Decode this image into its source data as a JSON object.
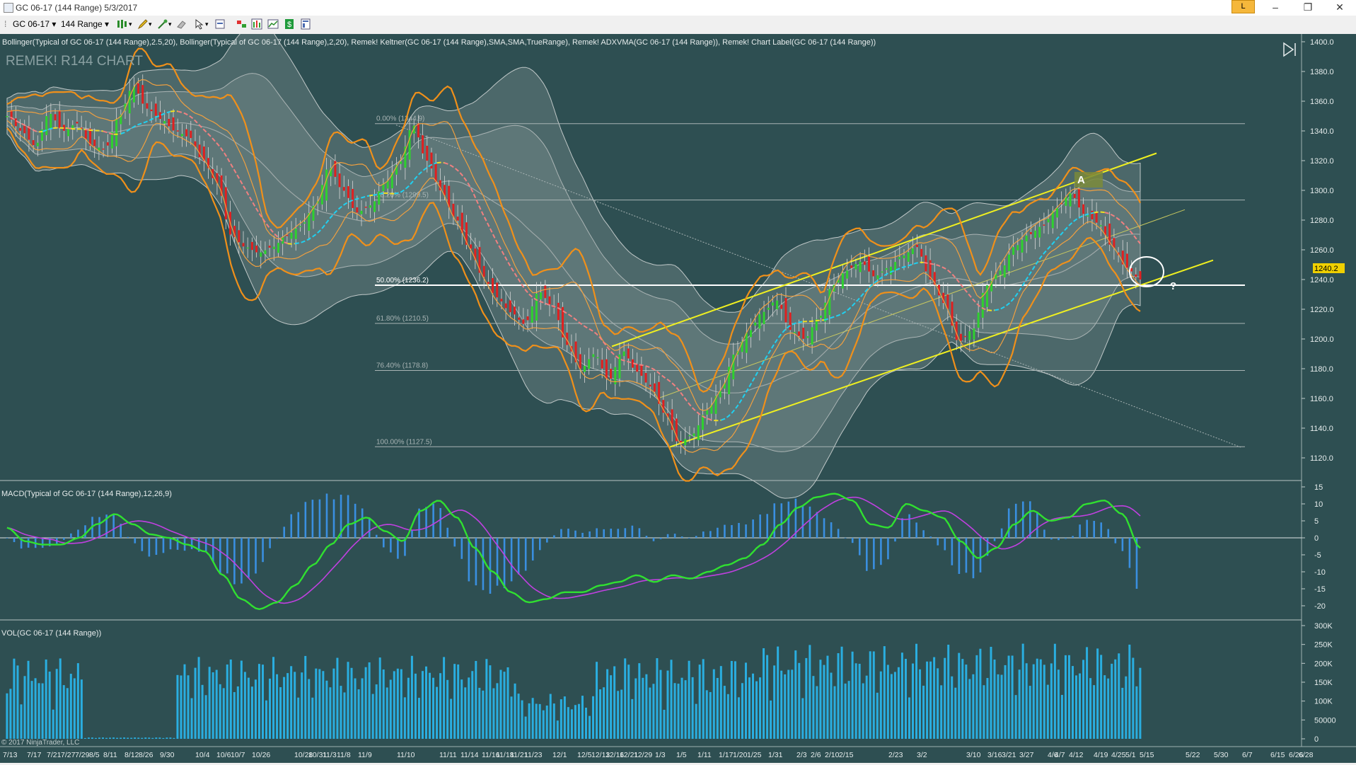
{
  "window": {
    "title": "GC 06-17 (144 Range)  5/3/2017",
    "badge": "L",
    "minimize": "–",
    "maximize": "❐",
    "close": "✕"
  },
  "toolbar": {
    "instrument": "GC 06-17",
    "period": "144 Range"
  },
  "price_panel": {
    "indicators_label": "Bollinger(Typical of GC 06-17 (144 Range),2.5,20), Bollinger(Typical of GC 06-17 (144 Range),2,20), Remek! Keltner(GC 06-17 (144 Range),SMA,SMA,TrueRange), Remek! ADXVMA(GC 06-17 (144 Range)), Remek! Chart Label(GC 06-17 (144 Range))",
    "watermark": "REMEK! R144 CHART",
    "label_a": "A",
    "question_mark": "?",
    "last_price": "1240.2",
    "copyright": "© 2017 NinjaTrader, LLC",
    "fib_levels": [
      {
        "label": "0.00% (1344.9)",
        "price": 1344.9
      },
      {
        "label": "38.20% (1299.5)",
        "price": 1293.5
      },
      {
        "label": "50.00% (1236.2)",
        "price": 1236.2
      },
      {
        "label": "61.80% (1210.5)",
        "price": 1210.5
      },
      {
        "label": "76.40% (1178.8)",
        "price": 1178.8
      },
      {
        "label": "100.00% (1127.5)",
        "price": 1127.5
      }
    ]
  },
  "macd_panel": {
    "label": "MACD(Typical of GC 06-17 (144 Range),12,26,9)"
  },
  "vol_panel": {
    "label": "VOL(GC 06-17 (144 Range))"
  },
  "x_axis_labels": [
    "7/13",
    "7/17",
    "7/21",
    "7/27",
    "7/29",
    "8/5",
    "8/11",
    "8/12",
    "8/26",
    "9/30",
    "10/4",
    "10/6",
    "10/7",
    "10/26",
    "10/28",
    "10/31",
    "11/3",
    "11/8",
    "11/9",
    "11/10",
    "11/11",
    "11/14",
    "11/16",
    "11/18",
    "11/21",
    "11/23",
    "12/1",
    "12/5",
    "12/13",
    "12/16",
    "12/21",
    "12/29",
    "1/3",
    "1/5",
    "1/11",
    "1/17",
    "1/20",
    "1/25",
    "1/31",
    "2/3",
    "2/6",
    "2/10",
    "2/15",
    "2/23",
    "3/2",
    "3/10",
    "3/16",
    "3/21",
    "3/27",
    "4/6",
    "4/7",
    "4/12",
    "4/19",
    "4/25",
    "5/1",
    "5/15",
    "5/22",
    "5/30",
    "6/7",
    "6/15",
    "6/26",
    "6/28"
  ],
  "chart_data": [
    {
      "type": "candlestick",
      "title": "GC 06-17 (144 Range)",
      "ylim": [
        1110,
        1400
      ],
      "y_ticks": [
        1120,
        1140,
        1160,
        1180,
        1200,
        1220,
        1240,
        1260,
        1280,
        1300,
        1320,
        1340,
        1360,
        1380,
        1400
      ],
      "last_price": 1240.2,
      "close_path": [
        1350,
        1340,
        1330,
        1352,
        1340,
        1345,
        1330,
        1328,
        1350,
        1370,
        1355,
        1348,
        1340,
        1336,
        1320,
        1305,
        1270,
        1262,
        1258,
        1262,
        1270,
        1276,
        1290,
        1316,
        1300,
        1285,
        1290,
        1305,
        1318,
        1344,
        1320,
        1300,
        1282,
        1262,
        1242,
        1228,
        1218,
        1210,
        1232,
        1222,
        1196,
        1180,
        1190,
        1172,
        1192,
        1178,
        1168,
        1150,
        1130,
        1136,
        1152,
        1165,
        1190,
        1205,
        1218,
        1226,
        1206,
        1200,
        1214,
        1236,
        1246,
        1252,
        1242,
        1248,
        1256,
        1262,
        1240,
        1224,
        1198,
        1206,
        1236,
        1246,
        1262,
        1270,
        1276,
        1288,
        1298,
        1284,
        1278,
        1262,
        1248,
        1240
      ]
    },
    {
      "type": "line",
      "title": "MACD(Typical of GC 06-17 (144 Range),12,26,9)",
      "ylim": [
        -22,
        16
      ],
      "y_ticks": [
        -20,
        -15,
        -10,
        -5,
        0,
        5,
        10,
        15
      ],
      "macd": [
        3,
        -1,
        -2,
        -2,
        0,
        4,
        7,
        4,
        1,
        0,
        -2,
        -4,
        -11,
        -18,
        -21,
        -19,
        -14,
        -8,
        -2,
        4,
        6,
        2,
        -1,
        8,
        11,
        6,
        -3,
        -10,
        -16,
        -19,
        -18,
        -16,
        -16,
        -14,
        -13,
        -11,
        -13,
        -11,
        -12,
        -10,
        -8,
        -6,
        -2,
        4,
        9,
        12,
        13,
        11,
        4,
        3,
        10,
        8,
        6,
        -1,
        -6,
        -3,
        4,
        8,
        5,
        6,
        10,
        11,
        7,
        -3
      ]
    },
    {
      "type": "bar",
      "title": "VOL(GC 06-17 (144 Range))",
      "ylim": [
        0,
        300000
      ],
      "y_ticks": [
        0,
        50000,
        100000,
        150000,
        200000,
        250000,
        300000
      ],
      "y_tick_labels": [
        "0",
        "50000",
        "100K",
        "150K",
        "200K",
        "250K",
        "300K"
      ]
    }
  ]
}
